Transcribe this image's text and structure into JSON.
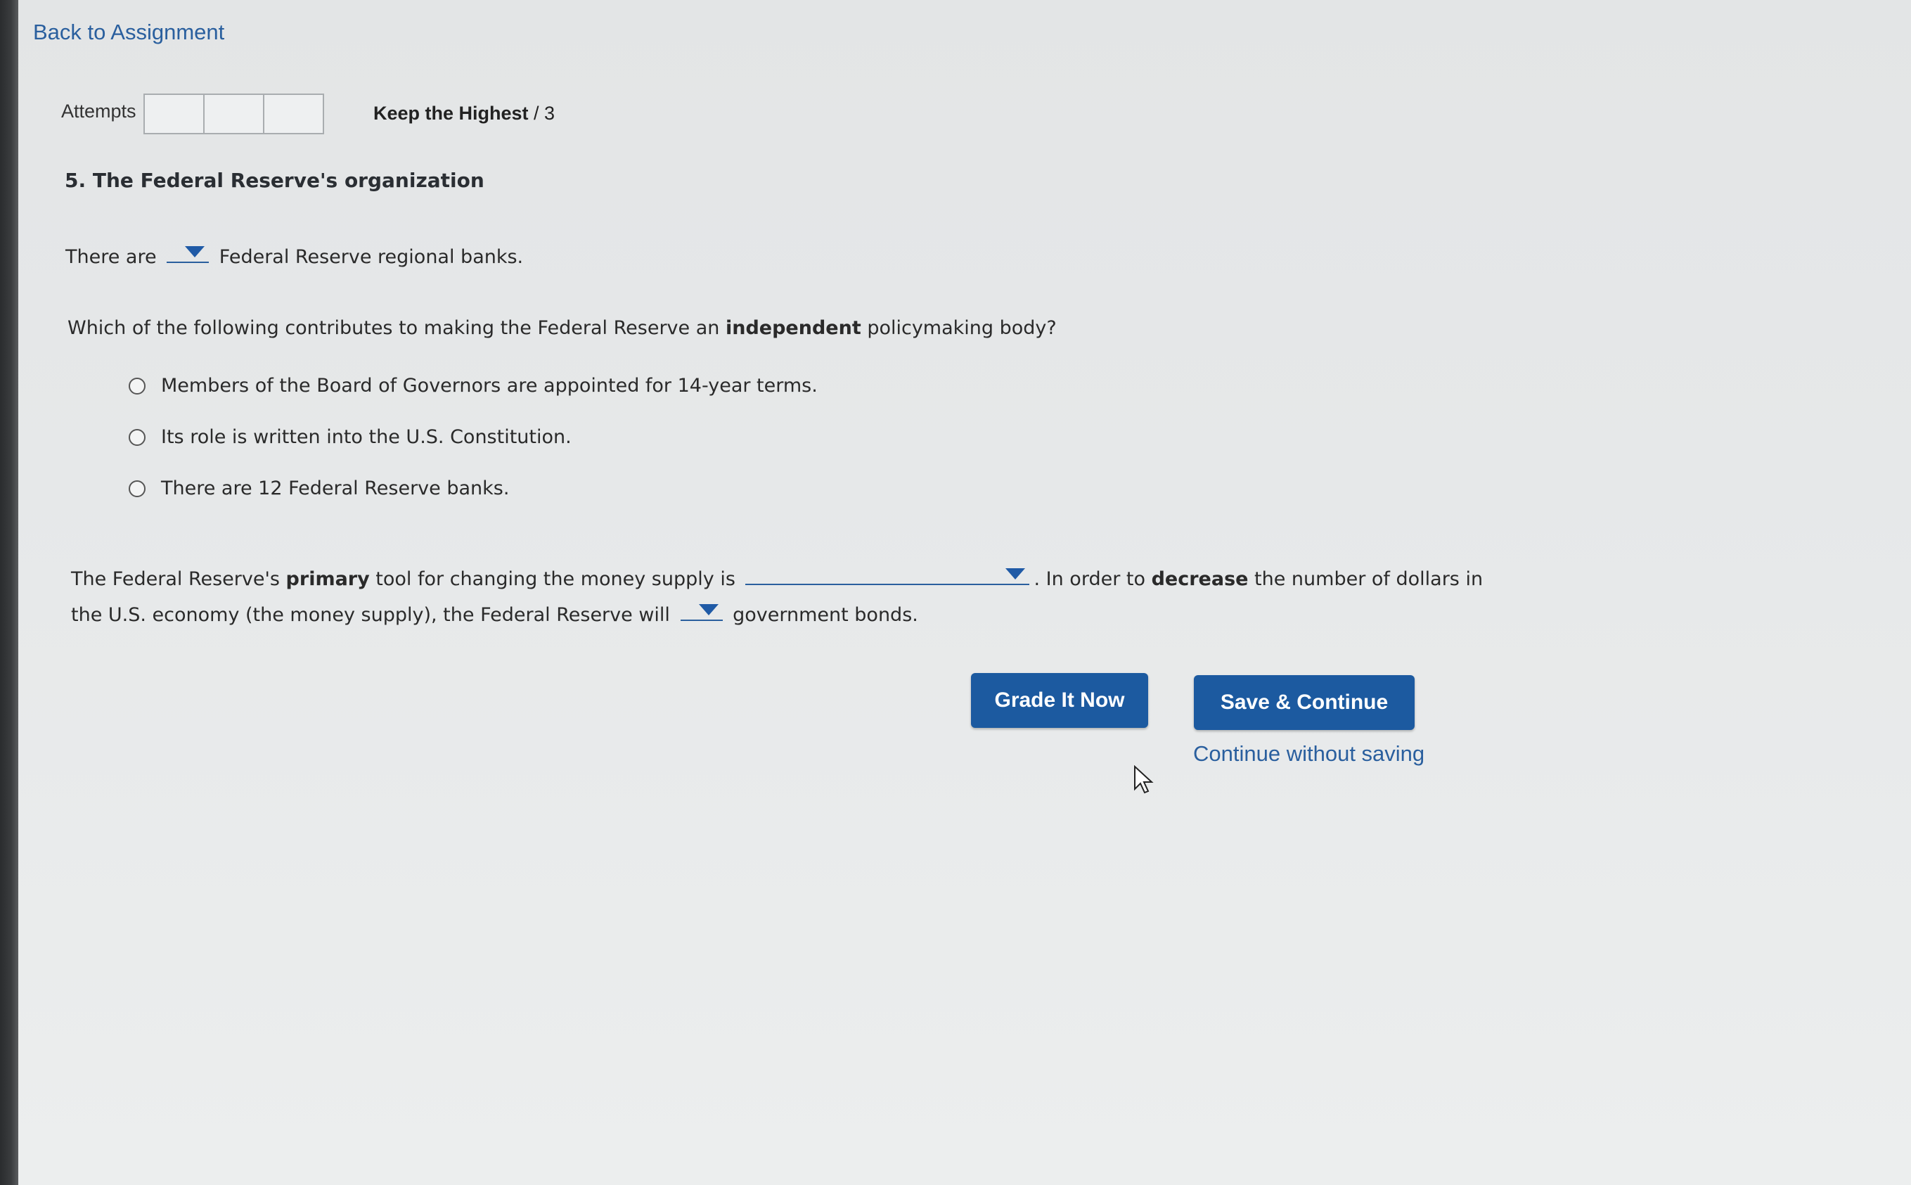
{
  "nav": {
    "back_label": "Back to Assignment"
  },
  "attempts": {
    "label": "Attempts",
    "boxes": [
      "",
      "",
      ""
    ],
    "keep_prefix": "Keep the Highest",
    "keep_suffix": " / 3"
  },
  "question": {
    "title": "5. The Federal Reserve's organization",
    "banks_line": {
      "before": "There are",
      "dropdown_value": "",
      "after": "Federal Reserve regional banks."
    },
    "independent_q": {
      "before": "Which of the following contributes to making the Federal Reserve an ",
      "bold": "independent",
      "after": " policymaking body?"
    },
    "options": [
      "Members of the Board of Governors are appointed for 14-year terms.",
      "Its role is written into the U.S. Constitution.",
      "There are 12 Federal Reserve banks."
    ],
    "tool_line": {
      "before": "The Federal Reserve's ",
      "bold1": "primary",
      "mid1": " tool for changing the money supply is",
      "dropdown1_value": "",
      "mid2": ". In order to ",
      "bold2": "decrease",
      "after": " the number of dollars in"
    },
    "tool_line2": {
      "before": "the U.S. economy (the money supply), the Federal Reserve will",
      "dropdown2_value": "",
      "after": "government bonds."
    }
  },
  "actions": {
    "grade_label": "Grade It Now",
    "save_label": "Save & Continue",
    "continue_label": "Continue without saving"
  },
  "colors": {
    "accent": "#1c5aa0",
    "link": "#2a5f9e"
  }
}
